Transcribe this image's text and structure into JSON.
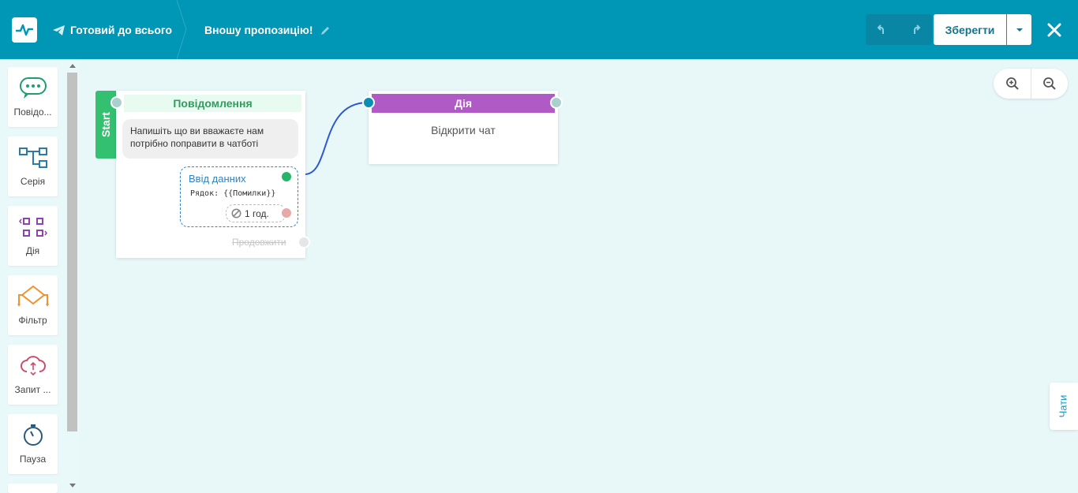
{
  "header": {
    "breadcrumb_bot": "Готовий до всього",
    "breadcrumb_flow": "Вношу пропозицію!",
    "save_label": "Зберегти"
  },
  "sidebar": {
    "items": [
      {
        "label": "Повідо...",
        "icon": "chat-bubble-icon"
      },
      {
        "label": "Серія",
        "icon": "flow-series-icon"
      },
      {
        "label": "Дія",
        "icon": "action-icon"
      },
      {
        "label": "Фільтр",
        "icon": "filter-icon"
      },
      {
        "label": "Запит ...",
        "icon": "cloud-request-icon"
      },
      {
        "label": "Пауза",
        "icon": "stopwatch-icon"
      }
    ]
  },
  "canvas": {
    "start_label": "Start",
    "message_node": {
      "title": "Повідомлення",
      "text": "Напишіть що ви вважаєте нам потрібно поправити в чатботі",
      "input_title": "Ввід данних",
      "input_subtitle": "Рядок: {{Помилки}}",
      "timeout": "1 год.",
      "continue": "Продовжити"
    },
    "action_node": {
      "title": "Дія",
      "body": "Відкрити чат"
    }
  },
  "chats_tab": "Чати",
  "colors": {
    "header": "#0096b6",
    "start": "#33c071",
    "action": "#b05ac6",
    "input": "#2f86c9",
    "canvas": "#e8f8f9"
  }
}
